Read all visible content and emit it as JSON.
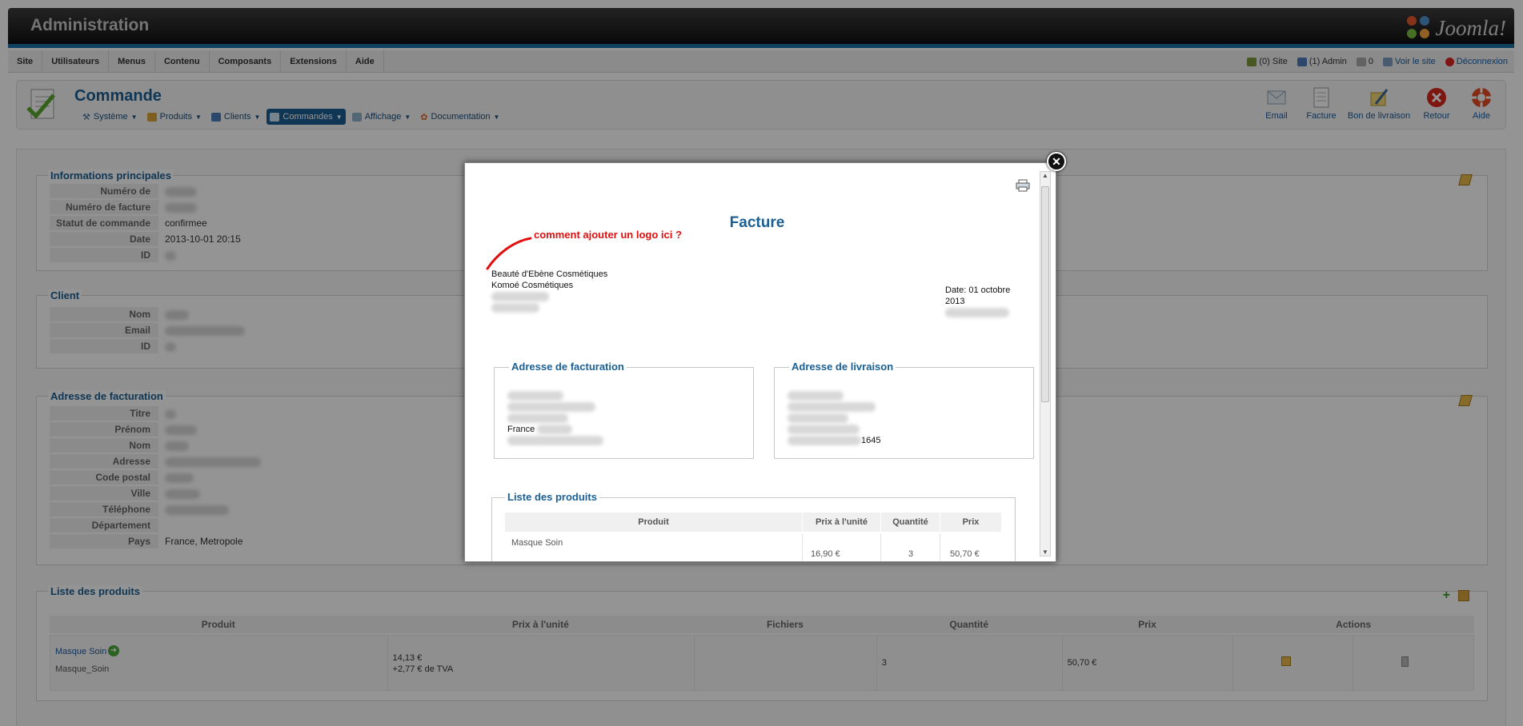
{
  "topbar": {
    "title": "Administration",
    "logo_text": "Joomla!"
  },
  "menu": {
    "items": [
      "Site",
      "Utilisateurs",
      "Menus",
      "Contenu",
      "Composants",
      "Extensions",
      "Aide"
    ]
  },
  "status": {
    "site": "(0) Site",
    "admin": "(1) Admin",
    "messages": "0",
    "view_site": "Voir le site",
    "logout": "Déconnexion"
  },
  "toolbar": {
    "page_title": "Commande",
    "submenu": [
      "Système",
      "Produits",
      "Clients",
      "Commandes",
      "Affichage",
      "Documentation"
    ],
    "actions": [
      "Email",
      "Facture",
      "Bon de livraison",
      "Retour",
      "Aide"
    ]
  },
  "main_info": {
    "legend": "Informations principales",
    "labels": [
      "Numéro de commande",
      "Numéro de facture",
      "Statut de commande",
      "Date",
      "ID"
    ],
    "status_value": "confirmee",
    "date_value": "2013-10-01 20:15"
  },
  "client": {
    "legend": "Client",
    "labels": [
      "Nom",
      "Email",
      "ID"
    ]
  },
  "billing_bg": {
    "legend": "Adresse de facturation",
    "labels": [
      "Titre",
      "Prénom",
      "Nom",
      "Adresse",
      "Code postal",
      "Ville",
      "Téléphone",
      "Département",
      "Pays"
    ],
    "country_value": "France, Metropole"
  },
  "products_bg": {
    "legend": "Liste des produits",
    "headers": [
      "Produit",
      "Prix à l'unité",
      "Fichiers",
      "Quantité",
      "Prix",
      "Actions"
    ],
    "row": {
      "name": "Masque Soin",
      "code": "Masque_Soin",
      "unit_price": "14,13 €",
      "tax": "+2,77 € de TVA",
      "qty": "3",
      "price": "50,70 €"
    }
  },
  "invoice": {
    "title": "Facture",
    "annotation": "comment ajouter un logo ici ?",
    "company_lines": [
      "Beauté d'Ebène Cosmétiques",
      "Komoé Cosmétiques"
    ],
    "date_line1": "Date: 01 octobre",
    "date_line2": "2013",
    "billing_legend": "Adresse de facturation",
    "billing_country": "France",
    "shipping_legend": "Adresse de livraison",
    "shipping_phone_tail": "1645",
    "products_legend": "Liste des produits",
    "headers": [
      "Produit",
      "Prix à l'unité",
      "Quantité",
      "Prix"
    ],
    "row": {
      "name": "Masque Soin",
      "unit_price": "16,90 €",
      "qty": "3",
      "price": "50,70 €"
    }
  },
  "colors": {
    "accent": "#1b5f93",
    "annotation": "#e01010",
    "topbar_stripe": "#1d6ea6"
  }
}
